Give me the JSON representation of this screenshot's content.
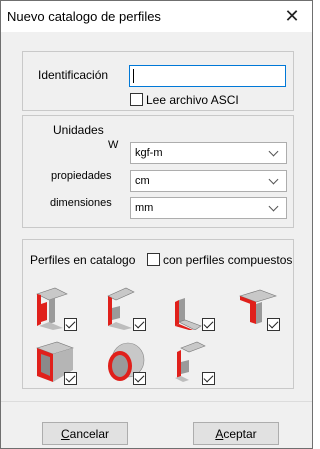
{
  "window": {
    "title": "Nuevo catalogo de perfiles",
    "close_glyph": "✕"
  },
  "identification": {
    "label": "Identificación",
    "value": "",
    "checkbox_label": "Lee archivo ASCI",
    "checkbox_checked": false
  },
  "units": {
    "group_label": "Unidades",
    "rows": [
      {
        "label": "W",
        "value": "kgf-m"
      },
      {
        "label": "propiedades",
        "value": "cm"
      },
      {
        "label": "dimensiones",
        "value": "mm"
      }
    ]
  },
  "catalog": {
    "label": "Perfiles en catalogo",
    "composite_label": "con perfiles compuestos",
    "composite_checked": false,
    "shapes": [
      {
        "icon": "i-beam-icon",
        "checked": true
      },
      {
        "icon": "channel-icon",
        "checked": true
      },
      {
        "icon": "angle-icon",
        "checked": true
      },
      {
        "icon": "tee-icon",
        "checked": true
      },
      {
        "icon": "rectangular-tube-icon",
        "checked": true
      },
      {
        "icon": "circular-tube-icon",
        "checked": true
      },
      {
        "icon": "z-section-icon",
        "checked": true
      }
    ]
  },
  "buttons": {
    "cancel_prefix": "C",
    "cancel_rest": "ancelar",
    "accept_prefix": "A",
    "accept_rest": "ceptar"
  },
  "colors": {
    "accent": "#0078d7",
    "section_red": "#e0201b"
  }
}
